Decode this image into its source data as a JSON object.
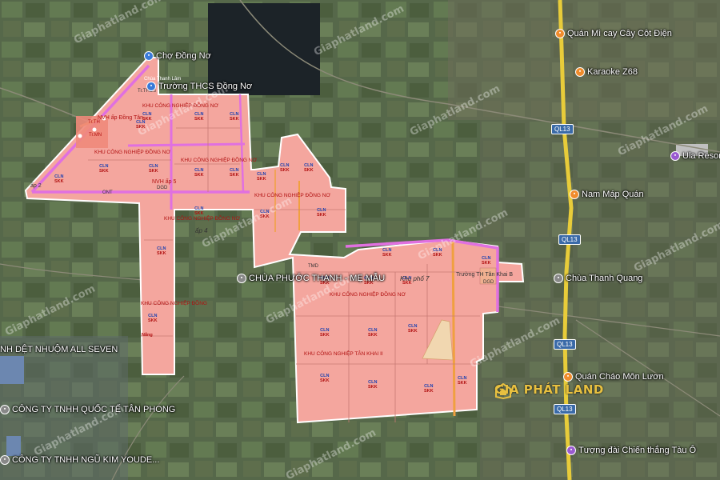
{
  "colors": {
    "planning_fill": "#f4a69e",
    "planning_border": "#ffffff",
    "road_pink": "#e070e0",
    "road_orange": "#f0a040",
    "highway_yellow": "#e8cc3a",
    "poi_orange": "#f08c2c",
    "poi_purple": "#9a5ad0",
    "poi_blue": "#3a7ad8"
  },
  "pois": [
    {
      "label": "Chợ Đồng Nơ",
      "icon": "market-icon",
      "color": "#3a7ad8"
    },
    {
      "label": "Trường THCS Đồng Nơ",
      "icon": "school-icon",
      "color": "#3a7ad8"
    },
    {
      "label": "Quán Mì cay Cây Cột Điện",
      "icon": "restaurant-icon",
      "color": "#f08c2c"
    },
    {
      "label": "Karaoke Z68",
      "icon": "karaoke-icon",
      "color": "#f08c2c"
    },
    {
      "label": "Ula Resort Củ Chi",
      "icon": "resort-icon",
      "color": "#9a5ad0"
    },
    {
      "label": "Nam Máp Quán",
      "icon": "restaurant-icon",
      "color": "#f08c2c"
    },
    {
      "label": "CHÙA PHƯỚC THẠNH - MẸ MẪU",
      "icon": "temple-icon",
      "color": "#888888"
    },
    {
      "label": "Chùa Thanh Quang",
      "icon": "temple-icon",
      "color": "#888888"
    },
    {
      "label": "NH DỆT NHUỘM ALL SEVEN",
      "icon": "factory-icon",
      "color": "#888888"
    },
    {
      "label": "CÔNG TY TNHH QUỐC TẾ TÂN PHONG",
      "icon": "company-icon",
      "color": "#888888"
    },
    {
      "label": "CÔNG TY TNHH NGŨ KIM YOUDE...",
      "icon": "company-icon",
      "color": "#888888"
    },
    {
      "label": "Quán Cháo Môn Lươn",
      "icon": "restaurant-icon",
      "color": "#f08c2c"
    },
    {
      "label": "Tượng đài Chiến thắng Tàu Ô",
      "icon": "monument-icon",
      "color": "#9a5ad0"
    }
  ],
  "highways": [
    "QL13",
    "QL13",
    "QL13",
    "QL13"
  ],
  "zones": [
    "KHU CÔNG NGHIỆP ĐỒNG NƠ",
    "KHU CÔNG NGHIỆP ĐỒNG NƠ",
    "KHU CÔNG NGHIỆP ĐỒNG NƠ",
    "KHU CÔNG NGHIỆP ĐỒNG NƠ",
    "KHU CÔNG NGHIỆP ĐỒNG NƠ",
    "KHU CÔNG NGHIỆP ĐỒNG NƠ",
    "KHU CÔNG NGHIỆP ĐỒNG",
    "KHU CÔNG NGHIỆP TÂN KHAI II"
  ],
  "places": [
    "NVH ấp Đồng Tân",
    "NVH ấp 5",
    "ấp 4",
    "ấp 2",
    "Khu phố 7",
    "Trường TH Tân Khai B",
    "Tr.MN",
    "Tr.TH",
    "Tr.THCS",
    "Chùa Thanh Lâm",
    "ONT",
    "TMD",
    "DGD",
    "DGD"
  ],
  "parcel": {
    "top": "CLN",
    "bottom": "SKK"
  },
  "parcel_bottom_alt": "Nắng",
  "watermark": "Giaphatland.com",
  "logo_text": "GIA PHÁT LAND"
}
